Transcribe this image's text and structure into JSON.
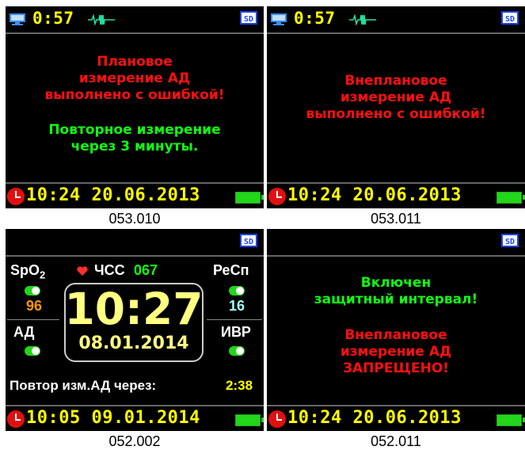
{
  "panels": [
    {
      "caption": "053.010",
      "time": "0:57",
      "lines": [
        "Плановое",
        "измерение АД",
        "выполнено с ошибкой!"
      ],
      "lines2": [
        "Повторное измерение",
        "через 3 минуты."
      ],
      "datetime": "10:24 20.06.2013"
    },
    {
      "caption": "053.011",
      "time": "0:57",
      "lines": [
        "Внеплановое",
        "измерение АД",
        "выполнено с ошибкой!"
      ],
      "datetime": "10:24 20.06.2013"
    },
    {
      "caption": "052.002",
      "spo2_label": "SpO",
      "spo2_sub": "2",
      "hr_label": "ЧСС",
      "hr_value": "067",
      "resp_label": "РеСп",
      "spo2_value": "96",
      "resp_value": "16",
      "bp_label": "АД",
      "ivr_label": "ИВР",
      "clock_time": "10:27",
      "clock_date": "08.01.2014",
      "repeat_label": "Повтор изм.АД через:",
      "repeat_value": "2:38",
      "datetime": "10:05 09.01.2014"
    },
    {
      "caption": "052.011",
      "lines": [
        "Включен",
        "защитный интервал!"
      ],
      "lines2": [
        "Внеплановое",
        "измерение АД",
        "ЗАПРЕЩЕНО!"
      ],
      "datetime": "10:24 20.06.2013"
    }
  ],
  "icons": {
    "device": "monitor-device-icon",
    "ecg": "ecg-signal-icon",
    "sd": "sd-card-icon",
    "clock": "alarm-clock-icon",
    "battery": "battery-full-icon",
    "heart": "heart-icon",
    "sd_text": "SD"
  },
  "colors": {
    "screen_bg": "#000000",
    "time_yellow": "#ffff00",
    "error_red": "#ff1010",
    "info_green": "#10ff10",
    "spo2_orange": "#ff9900",
    "resp_cyan": "#a0ffff"
  }
}
